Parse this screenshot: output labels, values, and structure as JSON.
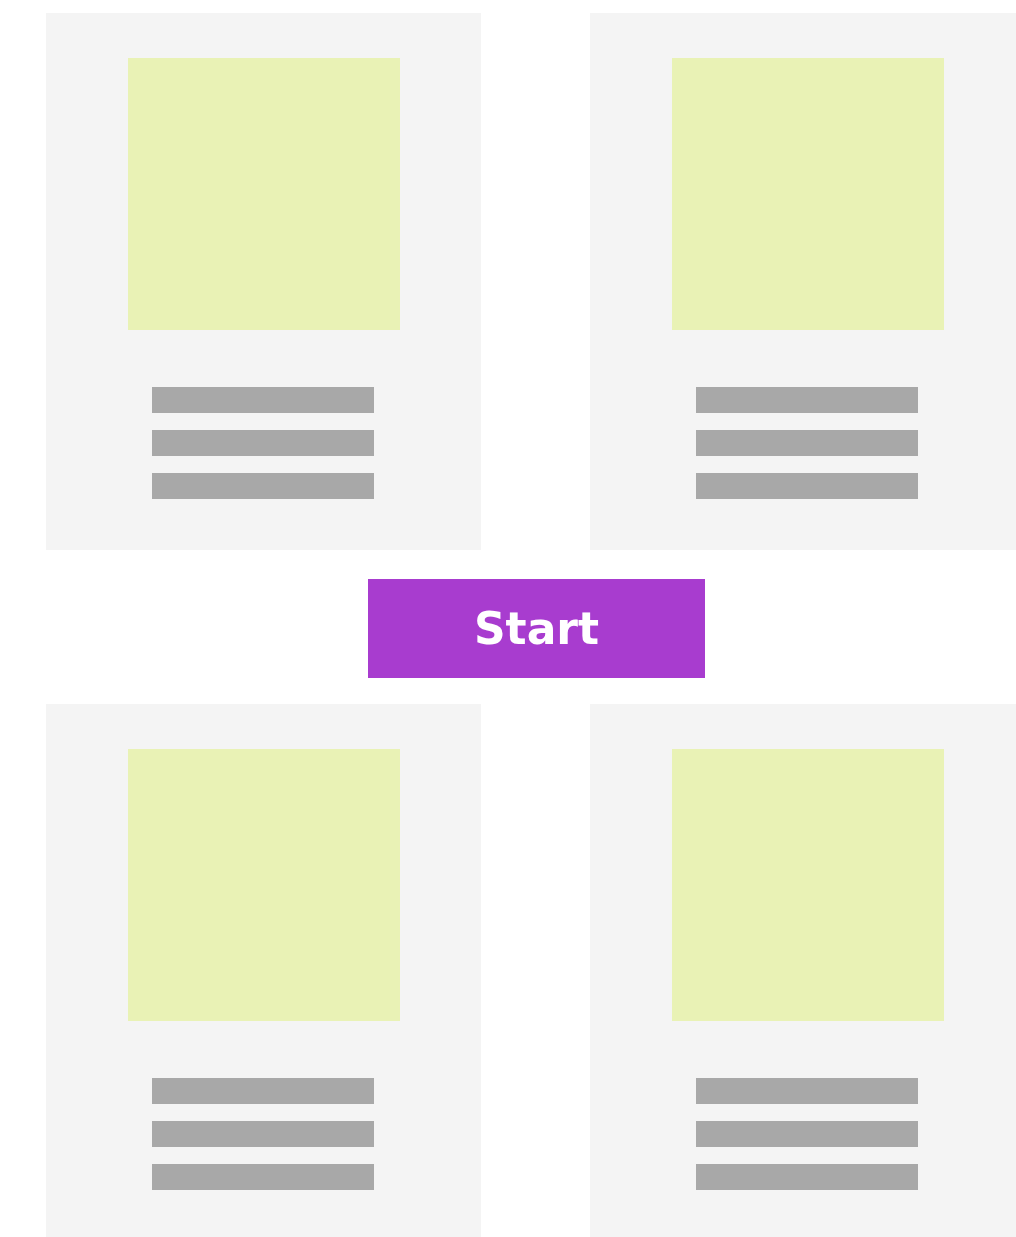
{
  "cards": [
    {
      "kind": "placeholder"
    },
    {
      "kind": "placeholder"
    },
    {
      "kind": "placeholder"
    },
    {
      "kind": "placeholder"
    }
  ],
  "button": {
    "label": "Start"
  }
}
